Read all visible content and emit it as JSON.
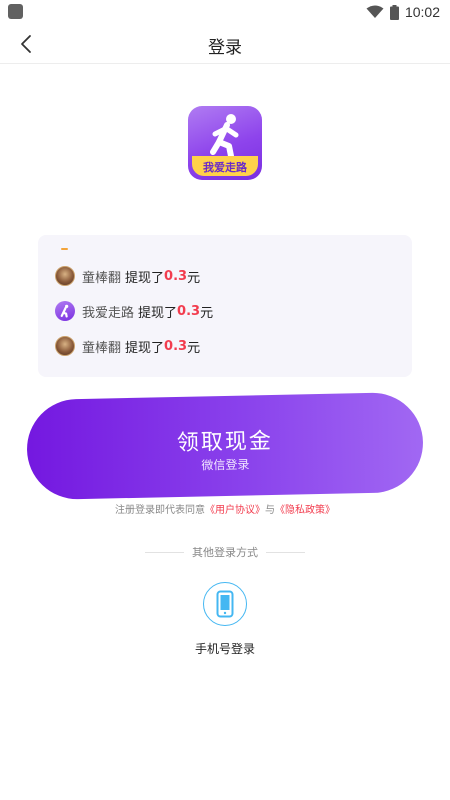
{
  "status_bar": {
    "time": "10:02"
  },
  "nav": {
    "title": "登录"
  },
  "logo": {
    "text": "我爱走路"
  },
  "feed": [
    {
      "name": "童棒翻",
      "action": "提现了",
      "amount": "0.3",
      "unit": "元",
      "avatar": "photo"
    },
    {
      "name": "我爱走路",
      "action": "提现了",
      "amount": "0.3",
      "unit": "元",
      "avatar": "app-logo"
    },
    {
      "name": "童棒翻",
      "action": "提现了",
      "amount": "0.3",
      "unit": "元",
      "avatar": "photo"
    }
  ],
  "main_button": {
    "title": "领取现金",
    "subtitle": "微信登录"
  },
  "agreement": {
    "prefix": "注册登录即代表同意",
    "user_agreement": "《用户协议》",
    "joiner": "与",
    "privacy_policy": "《隐私政策》"
  },
  "other_login": {
    "label": "其他登录方式",
    "phone_login": "手机号登录"
  },
  "colors": {
    "primary_purple": "#7418e0",
    "accent_red": "#f23c4e",
    "phone_blue": "#44b7f2",
    "logo_yellow": "#ffd24a"
  }
}
